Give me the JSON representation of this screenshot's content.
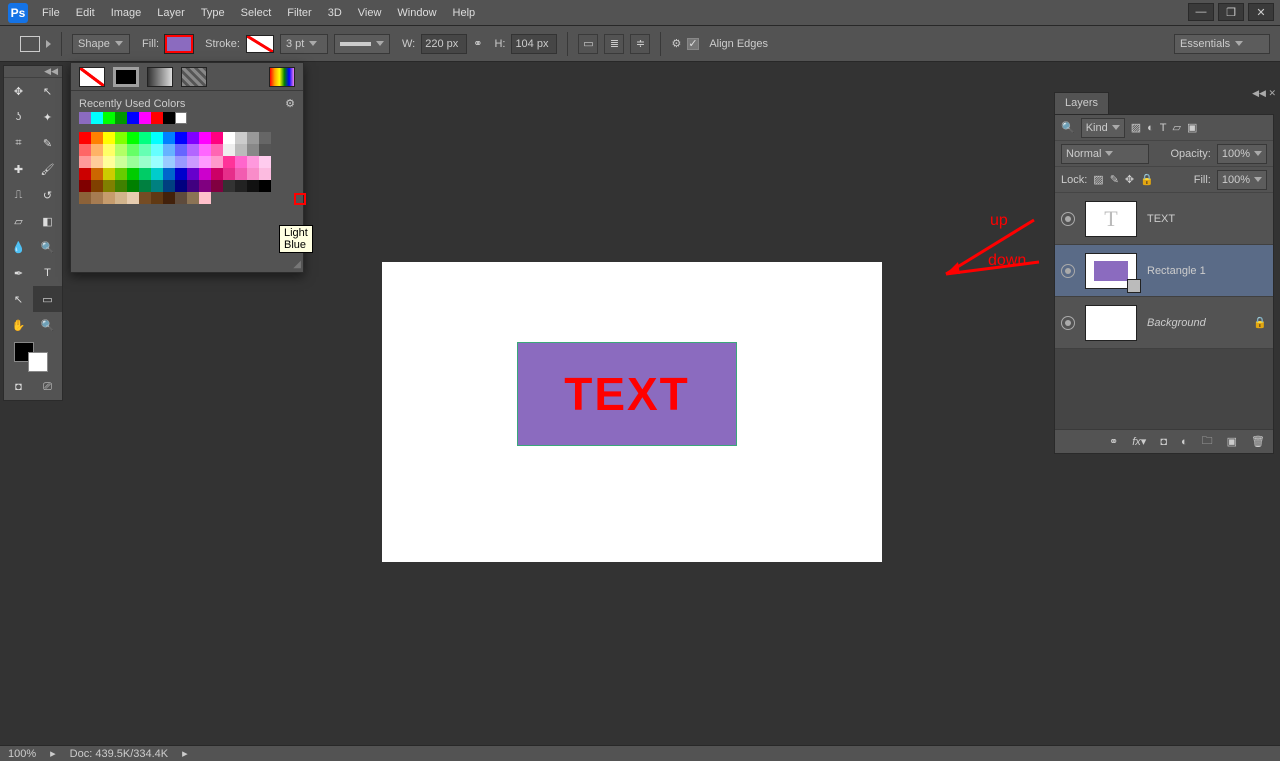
{
  "menu": {
    "items": [
      "File",
      "Edit",
      "Image",
      "Layer",
      "Type",
      "Select",
      "Filter",
      "3D",
      "View",
      "Window",
      "Help"
    ],
    "logo": "Ps"
  },
  "opt": {
    "tool_mode": "Shape",
    "fill_label": "Fill:",
    "stroke_label": "Stroke:",
    "stroke_w": "3 pt",
    "w_label": "W:",
    "w_val": "220 px",
    "h_label": "H:",
    "h_val": "104 px",
    "align_edges": "Align Edges",
    "workspace": "Essentials"
  },
  "colorpanel": {
    "section": "Recently Used Colors",
    "tooltip": "Light Blue"
  },
  "canvas": {
    "text": "TEXT"
  },
  "annot": {
    "up": "up",
    "down": "down"
  },
  "layers": {
    "tab": "Layers",
    "filter": "Kind",
    "blend": "Normal",
    "opacity_label": "Opacity:",
    "opacity": "100%",
    "lock_label": "Lock:",
    "fill_label": "Fill:",
    "fill_val": "100%",
    "items": [
      {
        "name": "TEXT",
        "type": "type"
      },
      {
        "name": "Rectangle 1",
        "type": "shape",
        "selected": true
      },
      {
        "name": "Background",
        "type": "bg",
        "locked": true
      }
    ]
  },
  "status": {
    "zoom": "100%",
    "doc": "Doc: 439.5K/334.4K"
  }
}
